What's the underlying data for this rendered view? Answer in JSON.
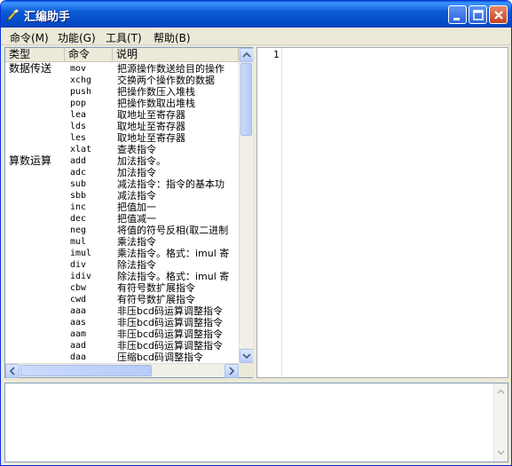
{
  "window": {
    "title": "汇编助手",
    "icon": "feather-pen-icon",
    "controls": [
      "minimize",
      "maximize",
      "close"
    ]
  },
  "menu": [
    {
      "label": "命令(M)"
    },
    {
      "label": "功能(G)"
    },
    {
      "label": "工具(T)"
    },
    {
      "label": "帮助(B)"
    }
  ],
  "list": {
    "columns": [
      "类型",
      "命令",
      "说明"
    ],
    "rows": [
      {
        "type": "数据传送",
        "cmd": "mov",
        "desc": "把源操作数送给目的操作"
      },
      {
        "type": "",
        "cmd": "xchg",
        "desc": "交换两个操作数的数据"
      },
      {
        "type": "",
        "cmd": "push",
        "desc": "把操作数压入堆栈"
      },
      {
        "type": "",
        "cmd": "pop",
        "desc": "把操作数取出堆栈"
      },
      {
        "type": "",
        "cmd": "lea",
        "desc": "取地址至寄存器"
      },
      {
        "type": "",
        "cmd": "lds",
        "desc": "取地址至寄存器"
      },
      {
        "type": "",
        "cmd": "les",
        "desc": "取地址至寄存器"
      },
      {
        "type": "",
        "cmd": "xlat",
        "desc": "查表指令"
      },
      {
        "type": "算数运算",
        "cmd": "add",
        "desc": "加法指令。"
      },
      {
        "type": "",
        "cmd": "adc",
        "desc": "加法指令"
      },
      {
        "type": "",
        "cmd": "sub",
        "desc": "减法指令：指令的基本功"
      },
      {
        "type": "",
        "cmd": "sbb",
        "desc": "减法指令"
      },
      {
        "type": "",
        "cmd": "inc",
        "desc": "把值加一"
      },
      {
        "type": "",
        "cmd": "dec",
        "desc": "把值减一"
      },
      {
        "type": "",
        "cmd": "neg",
        "desc": "将值的符号反相(取二进制"
      },
      {
        "type": "",
        "cmd": "mul",
        "desc": "乘法指令"
      },
      {
        "type": "",
        "cmd": "imul",
        "desc": "乘法指令。格式：imul 寄"
      },
      {
        "type": "",
        "cmd": "div",
        "desc": "除法指令"
      },
      {
        "type": "",
        "cmd": "idiv",
        "desc": "除法指令。格式：imul 寄"
      },
      {
        "type": "",
        "cmd": "cbw",
        "desc": "有符号数扩展指令"
      },
      {
        "type": "",
        "cmd": "cwd",
        "desc": "有符号数扩展指令"
      },
      {
        "type": "",
        "cmd": "aaa",
        "desc": "非压bcd码运算调整指令"
      },
      {
        "type": "",
        "cmd": "aas",
        "desc": "非压bcd码运算调整指令"
      },
      {
        "type": "",
        "cmd": "aam",
        "desc": "非压bcd码运算调整指令"
      },
      {
        "type": "",
        "cmd": "aad",
        "desc": "非压bcd码运算调整指令"
      },
      {
        "type": "",
        "cmd": "daa",
        "desc": "压缩bcd码调整指令"
      }
    ]
  },
  "editor": {
    "line_numbers": [
      "1"
    ],
    "content": ""
  },
  "output": {
    "content": ""
  },
  "colors": {
    "titlebar": "#0b5bd6",
    "chrome": "#ece9d8",
    "panel_border": "#7f9db9"
  }
}
